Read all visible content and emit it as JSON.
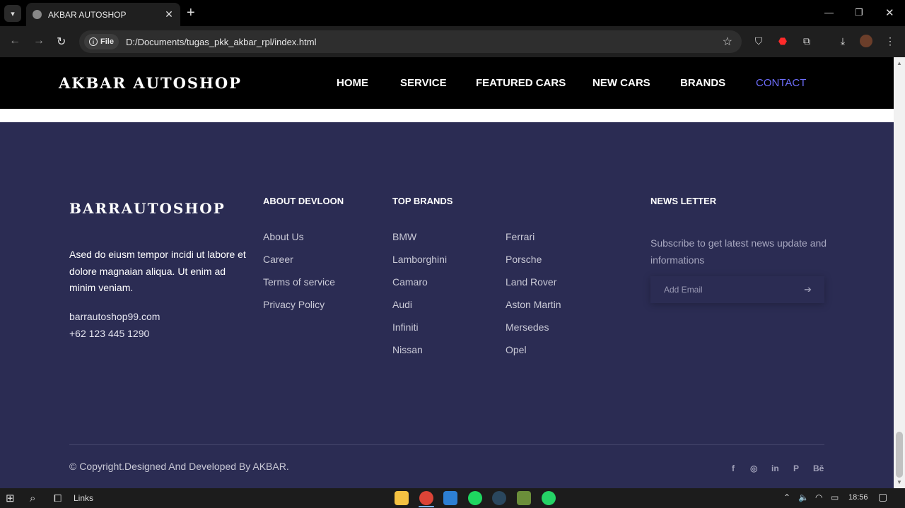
{
  "browser": {
    "tab_title": "AKBAR AUTOSHOP",
    "url_chip": "File",
    "url": "D:/Documents/tugas_pkk_akbar_rpl/index.html"
  },
  "site": {
    "logo": "AKBAR AUTOSHOP",
    "nav": [
      {
        "label": "HOME"
      },
      {
        "label": "SERVICE"
      },
      {
        "label": "FEATURED CARS"
      },
      {
        "label": "NEW CARS"
      },
      {
        "label": "BRANDS"
      },
      {
        "label": "CONTACT",
        "active": true
      }
    ],
    "accent_color": "#6d6dfa"
  },
  "footer": {
    "logo": "BARRAUTOSHOP",
    "description": "Ased do eiusm tempor incidi ut labore et dolore magnaian aliqua. Ut enim ad minim veniam.",
    "email": "barrautoshop99.com",
    "phone": "+62 123 445 1290",
    "about_title": "ABOUT DEVLOON",
    "about_links": [
      "About Us",
      "Career",
      "Terms of service",
      "Privacy Policy"
    ],
    "brands_title": "TOP BRANDS",
    "brands_col1": [
      "BMW",
      "Lamborghini",
      "Camaro",
      "Audi",
      "Infiniti",
      "Nissan"
    ],
    "brands_col2": [
      "Ferrari",
      "Porsche",
      "Land Rover",
      "Aston Martin",
      "Mersedes",
      "Opel"
    ],
    "news_title": "NEWS LETTER",
    "news_desc": "Subscribe to get latest news update and informations",
    "email_placeholder": "Add Email",
    "copyright": "© Copyright.Designed And Developed By AKBAR.",
    "socials": [
      "f",
      "◎",
      "in",
      "P",
      "Bē"
    ],
    "bg_color": "#2b2c53"
  },
  "taskbar": {
    "search_label": "Links",
    "time": "18:56"
  }
}
